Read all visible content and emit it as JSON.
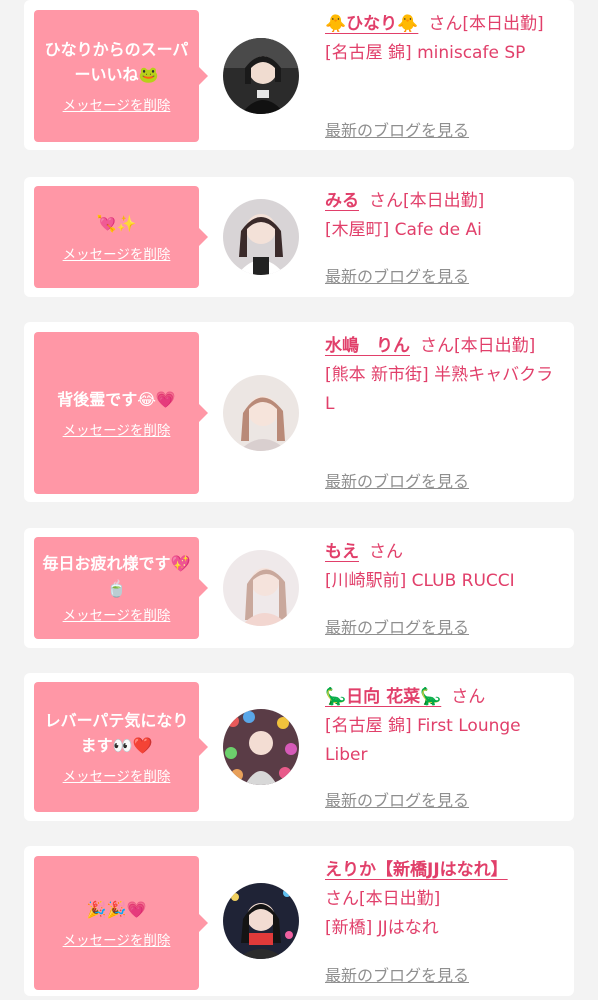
{
  "messages": [
    {
      "message": "ひなりからのスーパーいいね🐸",
      "delete_label": "メッセージを削除",
      "name": "🐥ひなり🐥",
      "honorific": "さん",
      "status": "[本日出勤]",
      "shop": "[名古屋 錦] miniscafe SP",
      "blog_link": "最新のブログを見る"
    },
    {
      "message": "💘✨",
      "delete_label": "メッセージを削除",
      "name": "みる",
      "honorific": "さん",
      "status": "[本日出勤]",
      "shop": "[木屋町] Cafe de Ai",
      "blog_link": "最新のブログを見る"
    },
    {
      "message": "背後霊です😂💗",
      "delete_label": "メッセージを削除",
      "name": "水嶋　りん",
      "honorific": "さん",
      "status": "[本日出勤]",
      "shop": "[熊本 新市街] 半熟キャバクラ L",
      "blog_link": "最新のブログを見る"
    },
    {
      "message": "毎日お疲れ様です💖🍵",
      "delete_label": "メッセージを削除",
      "name": "もえ",
      "honorific": "さん",
      "status": "",
      "shop": "[川崎駅前] CLUB RUCCI",
      "blog_link": "最新のブログを見る"
    },
    {
      "message": "レバーパテ気になります👀❤️",
      "delete_label": "メッセージを削除",
      "name": "🦕日向 花菜🦕",
      "honorific": "さん",
      "status": "",
      "shop": "[名古屋 錦] First Lounge Liber",
      "blog_link": "最新のブログを見る"
    },
    {
      "message": "🎉🎉💗",
      "delete_label": "メッセージを削除",
      "name": "えりか【新橋JJはなれ】",
      "honorific": "さん",
      "status": "[本日出勤]",
      "shop": "[新橋] JJはなれ",
      "blog_link": "最新のブログを見る"
    }
  ],
  "colors": {
    "bubble": "#ff97a6",
    "name": "#e13f6a",
    "link": "#8f8f8f",
    "background": "#f3f3f3"
  }
}
